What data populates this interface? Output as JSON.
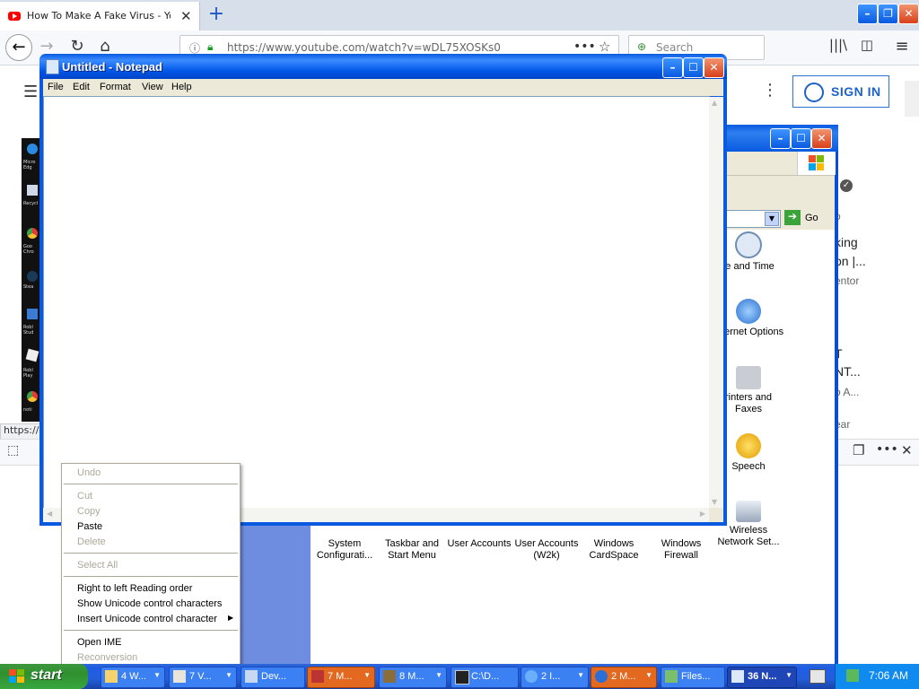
{
  "browser": {
    "tab_title": "How To Make A Fake Virus - YouTube",
    "url": "https://www.youtube.com/watch?v=wDL75XOSKs0",
    "search_placeholder": "Search",
    "status_url": "https://s",
    "signin_label": "SIGN IN",
    "right_snippets": [
      "king",
      "on |...",
      "entor",
      "T",
      "NT...",
      "o A...",
      "ear",
      "o"
    ]
  },
  "notepad": {
    "title": "Untitled - Notepad",
    "menus": [
      "File",
      "Edit",
      "Format",
      "View",
      "Help"
    ]
  },
  "context_menu": {
    "items": [
      {
        "label": "Undo",
        "enabled": false
      },
      {
        "label": "Cut",
        "enabled": false
      },
      {
        "label": "Copy",
        "enabled": false
      },
      {
        "label": "Paste",
        "enabled": true
      },
      {
        "label": "Delete",
        "enabled": false
      },
      {
        "label": "Select All",
        "enabled": false
      },
      {
        "label": "Right to left Reading order",
        "enabled": true
      },
      {
        "label": "Show Unicode control characters",
        "enabled": true
      },
      {
        "label": "Insert Unicode control character",
        "enabled": true,
        "submenu": true
      },
      {
        "label": "Open IME",
        "enabled": true
      },
      {
        "label": "Reconversion",
        "enabled": false
      }
    ]
  },
  "control_panel": {
    "go_label": "Go",
    "icons_right": [
      "te and Time",
      "Internet Options",
      "rinters and Faxes",
      "Speech",
      "Wireless Network Set..."
    ],
    "icons_bottom": [
      "System Configurati...",
      "Taskbar and Start Menu",
      "User Accounts",
      "User Accounts (W2k)",
      "Windows CardSpace",
      "Windows Firewall"
    ]
  },
  "taskbar": {
    "start_label": "start",
    "buttons": [
      "4 W...",
      "7 V...",
      "Dev...",
      "7 M...",
      "8 M...",
      "C:\\D...",
      "2 I...",
      "2 M...",
      "Files...",
      "36 N..."
    ],
    "clock": "7:06 AM"
  },
  "desktop_icons": [
    "Micro Edg",
    "Recycl",
    "Goo Chro",
    "Stea",
    "Robl Stud",
    "Robl Play",
    "noti"
  ]
}
